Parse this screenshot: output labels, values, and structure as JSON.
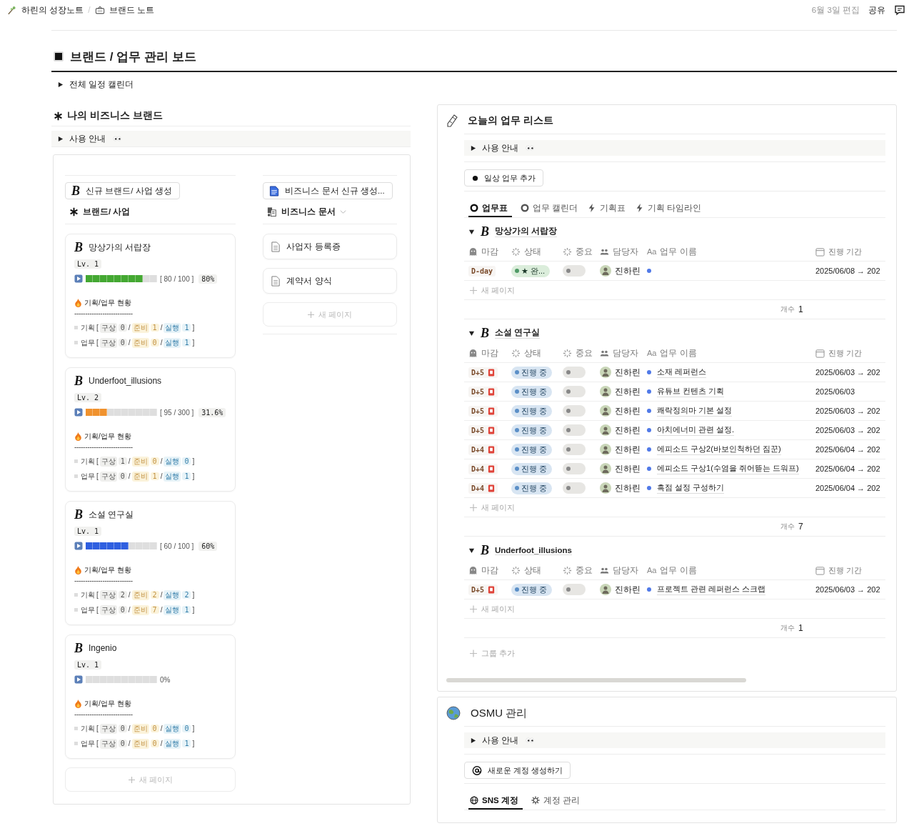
{
  "topbar": {
    "breadcrumbs": [
      {
        "kind": "branch",
        "label": "하린의 성장노트"
      },
      {
        "kind": "board",
        "label": "브랜드 노트"
      }
    ],
    "separator": "/",
    "edited": "6월 3일 편집",
    "share": "공유"
  },
  "page": {
    "title": "브랜드 / 업무 관리 보드",
    "toggle": {
      "label": "전체 일정 캘린더",
      "expanded": false
    }
  },
  "brands": {
    "title": "나의 비즈니스 브랜드",
    "guide": {
      "label": "사용 안내",
      "expanded": false
    },
    "board": {
      "new_button": {
        "letter": "B",
        "label": "신규 브랜드/ 사업 생성"
      },
      "view_label": "브랜드/ 사업",
      "cards": [
        {
          "letter": "B",
          "name": "망상가의 서랍장",
          "lv": "Lv. 1",
          "level": 0.8,
          "color": "#44a832",
          "reading": "[ 80 / 100 ]",
          "percent": {
            "kind": "badge",
            "text": "80%"
          },
          "status_title": "기획/업무 현황",
          "divider": "---------------------------",
          "rows": [
            {
              "label": "기획",
              "open": "[",
              "close": "]",
              "counts": [
                {
                  "kind": "idea",
                  "tag": "구상",
                  "value": "0",
                  "sep": "/"
                },
                {
                  "kind": "prep",
                  "tag": "준비",
                  "value": "1",
                  "sep": "/"
                },
                {
                  "kind": "run",
                  "tag": "실행",
                  "value": "1"
                }
              ]
            },
            {
              "label": "업무",
              "open": "[",
              "close": "]",
              "counts": [
                {
                  "kind": "idea",
                  "tag": "구상",
                  "value": "0",
                  "sep": "/"
                },
                {
                  "kind": "prep",
                  "tag": "준비",
                  "value": "0",
                  "sep": "/"
                },
                {
                  "kind": "run",
                  "tag": "실행",
                  "value": "1"
                }
              ]
            }
          ]
        },
        {
          "letter": "B",
          "name": "Underfoot_illusions",
          "lv": "Lv. 2",
          "level": 0.3,
          "color": "#f0922e",
          "reading": "[ 95 / 300 ]",
          "percent": {
            "kind": "badge",
            "text": "31.6%"
          },
          "status_title": "기획/업무 현황",
          "divider": "---------------------------",
          "rows": [
            {
              "label": "기획",
              "open": "[",
              "close": "]",
              "counts": [
                {
                  "kind": "idea",
                  "tag": "구상",
                  "value": "1",
                  "sep": "/"
                },
                {
                  "kind": "prep",
                  "tag": "준비",
                  "value": "0",
                  "sep": "/"
                },
                {
                  "kind": "run",
                  "tag": "실행",
                  "value": "0"
                }
              ]
            },
            {
              "label": "업무",
              "open": "[",
              "close": "]",
              "counts": [
                {
                  "kind": "idea",
                  "tag": "구상",
                  "value": "0",
                  "sep": "/"
                },
                {
                  "kind": "prep",
                  "tag": "준비",
                  "value": "1",
                  "sep": "/"
                },
                {
                  "kind": "run",
                  "tag": "실행",
                  "value": "1"
                }
              ]
            }
          ]
        },
        {
          "letter": "B",
          "name": "소설 연구실",
          "lv": "Lv. 1",
          "level": 0.6,
          "color": "#2f5fe0",
          "reading": "[ 60 / 100 ]",
          "percent": {
            "kind": "badge",
            "text": "60%"
          },
          "status_title": "기획/업무 현황",
          "divider": "---------------------------",
          "rows": [
            {
              "label": "기획",
              "open": "[",
              "close": "]",
              "counts": [
                {
                  "kind": "idea",
                  "tag": "구상",
                  "value": "2",
                  "sep": "/"
                },
                {
                  "kind": "prep",
                  "tag": "준비",
                  "value": "2",
                  "sep": "/"
                },
                {
                  "kind": "run",
                  "tag": "실행",
                  "value": "2"
                }
              ]
            },
            {
              "label": "업무",
              "open": "[",
              "close": "]",
              "counts": [
                {
                  "kind": "idea",
                  "tag": "구상",
                  "value": "0",
                  "sep": "/"
                },
                {
                  "kind": "prep",
                  "tag": "준비",
                  "value": "7",
                  "sep": "/"
                },
                {
                  "kind": "run",
                  "tag": "실행",
                  "value": "1"
                }
              ]
            }
          ]
        },
        {
          "letter": "B",
          "name": "Ingenio",
          "lv": "Lv. 1",
          "level": 0,
          "percent": {
            "kind": "plain",
            "text": "0%"
          },
          "status_title": "기획/업무 현황",
          "divider": "---------------------------",
          "rows": [
            {
              "label": "기획",
              "open": "[",
              "close": "]",
              "counts": [
                {
                  "kind": "idea",
                  "tag": "구상",
                  "value": "0",
                  "sep": "/"
                },
                {
                  "kind": "prep",
                  "tag": "준비",
                  "value": "0",
                  "sep": "/"
                },
                {
                  "kind": "run",
                  "tag": "실행",
                  "value": "0"
                }
              ]
            },
            {
              "label": "업무",
              "open": "[",
              "close": "]",
              "counts": [
                {
                  "kind": "idea",
                  "tag": "구상",
                  "value": "0",
                  "sep": "/"
                },
                {
                  "kind": "prep",
                  "tag": "준비",
                  "value": "0",
                  "sep": "/"
                },
                {
                  "kind": "run",
                  "tag": "실행",
                  "value": "1"
                }
              ]
            }
          ]
        }
      ],
      "new_page": "새 페이지"
    },
    "docs": {
      "new_button": "비즈니스 문서 신규 생성...",
      "view_label": "비즈니스 문서",
      "items": [
        {
          "label": "사업자 등록증"
        },
        {
          "label": "계약서 양식"
        }
      ],
      "new_page": "새 페이지"
    }
  },
  "tasks": {
    "title": "오늘의 업무 리스트",
    "guide": {
      "label": "사용 안내",
      "expanded": false
    },
    "add_button": "일상 업무 추가",
    "tabs": [
      {
        "kind": "table",
        "label": "업무표",
        "selected": true
      },
      {
        "kind": "calendar",
        "label": "업무 캘린더",
        "selected": false
      },
      {
        "kind": "chart",
        "label": "기획표",
        "selected": false
      },
      {
        "kind": "timeline",
        "label": "기획 타임라인",
        "selected": false
      }
    ],
    "groups": [
      {
        "letter": "B",
        "name": "망상가의 서랍장",
        "expanded": true,
        "columns": [
          {
            "kind": "due",
            "label": "마감"
          },
          {
            "kind": "status",
            "label": "상태"
          },
          {
            "kind": "priority",
            "label": "중요"
          },
          {
            "kind": "person",
            "label": "담당자"
          },
          {
            "kind": "title",
            "prefix": "Aa",
            "label": "업무 이름"
          },
          {
            "kind": "date",
            "label": "진행 기간"
          }
        ],
        "rows": [
          {
            "due": "D-day",
            "alarm": false,
            "status": {
              "kind": "done",
              "text": "★ 완..."
            },
            "important": false,
            "assignee": "진하린",
            "period": "2025/06/08 → 202"
          }
        ],
        "new_page": "새 페이지",
        "count_label": "개수",
        "count": "1"
      },
      {
        "letter": "B",
        "name": "소설 연구실",
        "expanded": true,
        "columns": [
          {
            "kind": "due",
            "label": "마감"
          },
          {
            "kind": "status",
            "label": "상태"
          },
          {
            "kind": "priority",
            "label": "중요"
          },
          {
            "kind": "person",
            "label": "담당자"
          },
          {
            "kind": "title",
            "prefix": "Aa",
            "label": "업무 이름"
          },
          {
            "kind": "date",
            "label": "진행 기간"
          }
        ],
        "rows": [
          {
            "due": "D+5",
            "alarm": true,
            "status": {
              "kind": "progress",
              "text": "진행 중"
            },
            "important": false,
            "assignee": "진하린",
            "task": "소재 레퍼런스",
            "period": "2025/06/03 → 202"
          },
          {
            "due": "D+5",
            "alarm": true,
            "status": {
              "kind": "progress",
              "text": "진행 중"
            },
            "important": false,
            "assignee": "진하린",
            "task": "유튜브 컨텐츠 기획",
            "period": "2025/06/03"
          },
          {
            "due": "D+5",
            "alarm": true,
            "status": {
              "kind": "progress",
              "text": "진행 중"
            },
            "important": false,
            "assignee": "진하린",
            "task": "쾌락정의마 기본 설정",
            "period": "2025/06/03 → 202"
          },
          {
            "due": "D+5",
            "alarm": true,
            "status": {
              "kind": "progress",
              "text": "진행 중"
            },
            "important": false,
            "assignee": "진하린",
            "task": "아치에너미 관련 설정.",
            "period": "2025/06/03 → 202"
          },
          {
            "due": "D+4",
            "alarm": true,
            "status": {
              "kind": "progress",
              "text": "진행 중"
            },
            "important": false,
            "assignee": "진하린",
            "task": "에피소드 구상2(바보인척하던 짐꾼)",
            "period": "2025/06/04 → 202"
          },
          {
            "due": "D+4",
            "alarm": true,
            "status": {
              "kind": "progress",
              "text": "진행 중"
            },
            "important": false,
            "assignee": "진하린",
            "task": "에피소드 구상1(수염을 쥐어뜯는 드워프)",
            "period": "2025/06/04 → 202"
          },
          {
            "due": "D+4",
            "alarm": true,
            "status": {
              "kind": "progress",
              "text": "진행 중"
            },
            "important": false,
            "assignee": "진하린",
            "task": "흑점 설정 구성하기",
            "period": "2025/06/04 → 202"
          }
        ],
        "new_page": "새 페이지",
        "count_label": "개수",
        "count": "7"
      },
      {
        "letter": "B",
        "name": "Underfoot_illusions",
        "expanded": true,
        "columns": [
          {
            "kind": "due",
            "label": "마감"
          },
          {
            "kind": "status",
            "label": "상태"
          },
          {
            "kind": "priority",
            "label": "중요"
          },
          {
            "kind": "person",
            "label": "담당자"
          },
          {
            "kind": "title",
            "prefix": "Aa",
            "label": "업무 이름"
          },
          {
            "kind": "date",
            "label": "진행 기간"
          }
        ],
        "rows": [
          {
            "due": "D+5",
            "alarm": true,
            "status": {
              "kind": "progress",
              "text": "진행 중"
            },
            "important": false,
            "assignee": "진하린",
            "task": "프로젝트 관련 레퍼런스 스크랩",
            "period": "2025/06/03 → 202"
          }
        ],
        "new_page": "새 페이지",
        "count_label": "개수",
        "count": "1"
      }
    ],
    "add_group": "그룹 추가"
  },
  "osmu": {
    "title": "OSMU 관리",
    "guide": {
      "label": "사용 안내",
      "expanded": false
    },
    "add_button": "새로운 계정 생성하기",
    "tabs": [
      {
        "kind": "sns",
        "label": "SNS 계정",
        "selected": true
      },
      {
        "kind": "settings",
        "label": "계정 관리",
        "selected": false
      }
    ]
  }
}
